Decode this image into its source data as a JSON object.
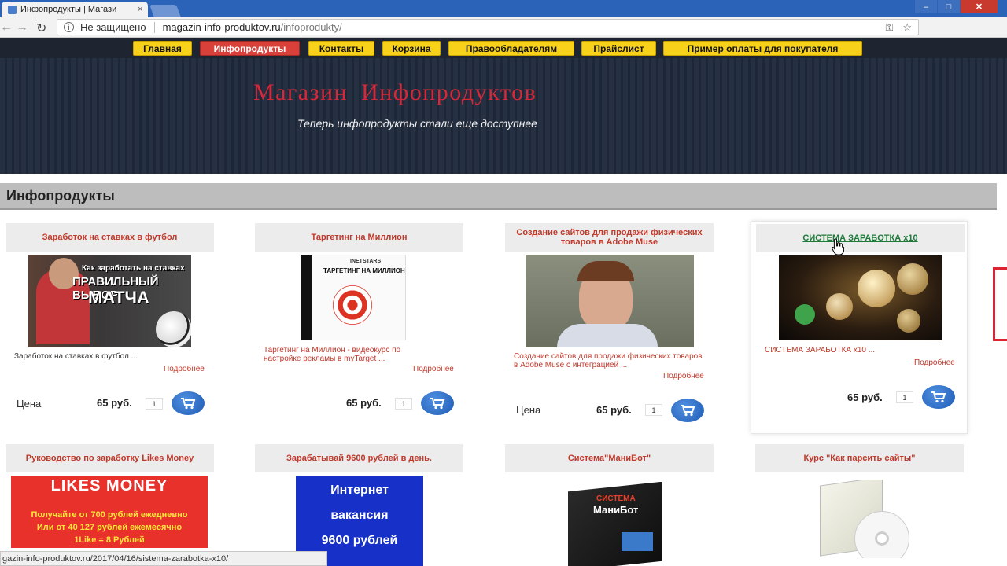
{
  "browser": {
    "tab_title": "Инфопродукты | Магази",
    "tab_close": "×",
    "security_text": "Не защищено",
    "url_host": "magazin-info-produktov.ru",
    "url_path": "/infoprodukty/",
    "status_url": "gazin-info-produktov.ru/2017/04/16/sistema-zarabotka-x10/"
  },
  "nav": {
    "items": [
      {
        "label": "Главная"
      },
      {
        "label": "Инфопродукты",
        "active": true
      },
      {
        "label": "Контакты"
      },
      {
        "label": "Корзина"
      },
      {
        "label": "Правообладателям"
      },
      {
        "label": "Прайслист"
      },
      {
        "label": "Пример оплаты для покупателя"
      }
    ]
  },
  "hero": {
    "title": "Магазин Инфопродуктов",
    "subtitle": "Теперь инфопродукты стали еще доступнее"
  },
  "section": {
    "title": "Инфопродукты"
  },
  "products": [
    {
      "title": "Заработок на ставках в футбол",
      "image_text_1": "Как заработать на ставках",
      "image_text_2": "ПРАВИЛЬНЫЙ ВЫБОР",
      "image_text_3": "МАТЧА",
      "description": "Заработок на ставках в футбол ...",
      "more": "Подробнее",
      "price_label": "Цена",
      "price": "65 руб.",
      "qty": "1"
    },
    {
      "title": "Таргетинг на Миллион",
      "image_text_1": "INETSTARS",
      "image_text_2": "ТАРГЕТИНГ НА МИЛЛИОН",
      "description": "Таргетинг на Миллион - видеокурс по настройке рекламы в myTarget ...",
      "more": "Подробнее",
      "price": "65 руб.",
      "qty": "1"
    },
    {
      "title": "Создание сайтов для продажи физических товаров в Adobe Muse",
      "description": "Создание сайтов для продажи физических товаров в Adobe Muse с интеграцией ...",
      "more": "Подробнее",
      "price_label": "Цена",
      "price": "65 руб.",
      "qty": "1"
    },
    {
      "title": "СИСТЕМА ЗАРАБОТКА x10",
      "description": "СИСТЕМА ЗАРАБОТКА x10 ...",
      "more": "Подробнее",
      "price": "65 руб.",
      "qty": "1"
    },
    {
      "title": "Руководство по заработку Likes Money",
      "image_text_1": "LIKES MONEY",
      "image_text_2": "Получайте от 700 рублей ежедневно",
      "image_text_3": "Или от 40 127 рублей ежемесячно",
      "image_text_4": "1Like = 8 Рублей"
    },
    {
      "title": "Зарабатывай 9600 рублей в день.",
      "image_text_1": "Интернет",
      "image_text_2": "вакансия",
      "image_text_3": "9600 рублей"
    },
    {
      "title": "Система\"МаниБот\"",
      "image_text_1": "СИСТЕМА",
      "image_text_2": "МаниБот"
    },
    {
      "title": "Курс \"Как парсить сайты\""
    }
  ],
  "colors": {
    "accent_red": "#d6283a",
    "nav_yellow": "#f7d11a",
    "cart_blue": "#1f5bb5"
  }
}
